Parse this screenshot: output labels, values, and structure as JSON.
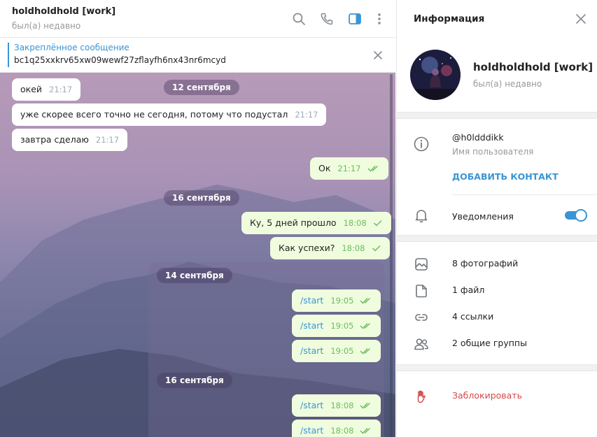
{
  "chat": {
    "title": "holdholdhold [work]",
    "status": "был(а) недавно",
    "pinned": {
      "title": "Закреплённое сообщение",
      "text": "bc1q25xxkrv65xw09wewf27zflayfh6nx43nr6mcyd"
    },
    "icons": [
      "search-icon",
      "phone-icon",
      "sidebar-toggle-icon",
      "more-vert-icon",
      "close-icon"
    ],
    "messages": [
      {
        "type": "in",
        "text": "окей",
        "time": "21:17"
      },
      {
        "type": "date",
        "text": "12 сентября"
      },
      {
        "type": "in",
        "text": "уже скорее всего точно не сегодня, потому что подустал",
        "time": "21:17"
      },
      {
        "type": "in",
        "text": "завтра сделаю",
        "time": "21:17"
      },
      {
        "type": "out",
        "text": "Ок",
        "time": "21:17",
        "read": true
      },
      {
        "type": "date",
        "text": "16 сентября"
      },
      {
        "type": "out",
        "text": "Ку, 5 дней прошло",
        "time": "18:08",
        "read": false
      },
      {
        "type": "out",
        "text": "Как успехи?",
        "time": "18:08",
        "read": false
      }
    ],
    "forwarded": {
      "date1": "14 сентября",
      "date2": "16 сентября",
      "messages": [
        {
          "text": "/start",
          "time": "19:05"
        },
        {
          "text": "/start",
          "time": "19:05"
        },
        {
          "text": "/start",
          "time": "19:05"
        },
        {
          "text": "/start",
          "time": "18:08"
        },
        {
          "text": "/start",
          "time": "18:08"
        }
      ]
    }
  },
  "info": {
    "title": "Информация",
    "name": "holdholdhold [work]",
    "status": "был(а) недавно",
    "username": "@h0ldddikk",
    "username_label": "Имя пользователя",
    "add_contact": "ДОБАВИТЬ КОНТАКТ",
    "notifications_label": "Уведомления",
    "notifications_on": true,
    "media": [
      {
        "icon": "photo-icon",
        "label": "8 фотографий"
      },
      {
        "icon": "file-icon",
        "label": "1 файл"
      },
      {
        "icon": "link-icon",
        "label": "4 ссылки"
      },
      {
        "icon": "group-icon",
        "label": "2 общие группы"
      }
    ],
    "block": "Заблокировать"
  },
  "colors": {
    "accent": "#3a95d5",
    "outgoing_bubble": "#effdde",
    "read_check": "#6cbd5e",
    "danger": "#d24949"
  }
}
